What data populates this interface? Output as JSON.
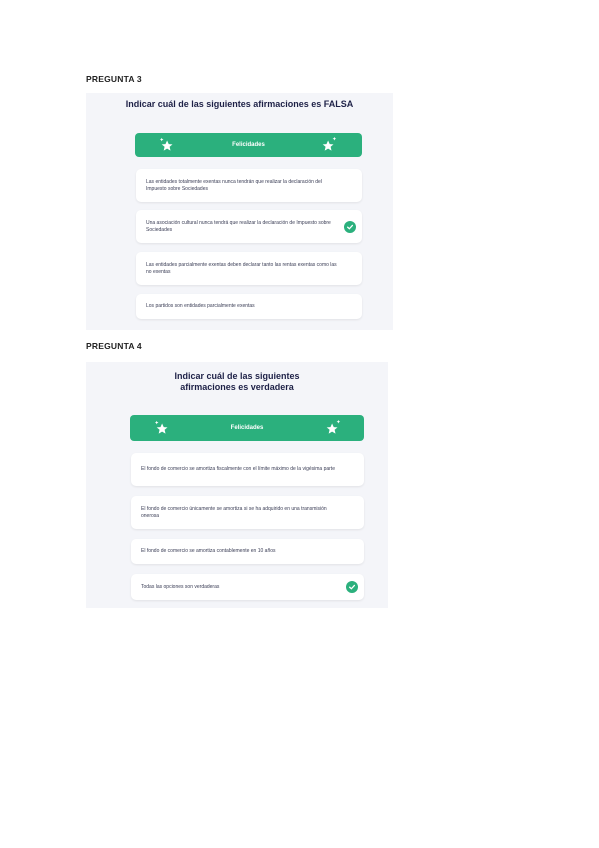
{
  "q3": {
    "label": "PREGUNTA 3",
    "title": "Indicar cuál de las siguientes afirmaciones es FALSA",
    "banner": "Felicidades",
    "options": [
      "Las entidades totalmente exentas nunca tendrán que realizar la declaración del Impuesto sobre Sociedades",
      "Una asociación cultural nunca tendrá que realizar la declaración de Impuesto sobre Sociedades",
      "Las entidades parcialmente exentas deben declarar tanto las rentas exentas como las no exentas",
      "Los partidos son entidades parcialmente exentas"
    ]
  },
  "q4": {
    "label": "PREGUNTA 4",
    "title": "Indicar cuál de las siguientes afirmaciones es verdadera",
    "banner": "Felicidades",
    "options": [
      "El fondo de comercio se amortiza fiscalmente con el límite máximo de la vigésima parte",
      "El fondo de comercio únicamente se amortiza si se ha adquirido en una transmisión onerosa",
      "El fondo de comercio se amortiza contablemente en 10 años",
      "Todas las opciones son verdaderas"
    ]
  },
  "colors": {
    "accent": "#2bb07d",
    "panel": "#f4f5f9",
    "title": "#1e2147"
  },
  "icons": {
    "banner": "sparkle-star-icon",
    "correct": "check-circle-icon"
  }
}
